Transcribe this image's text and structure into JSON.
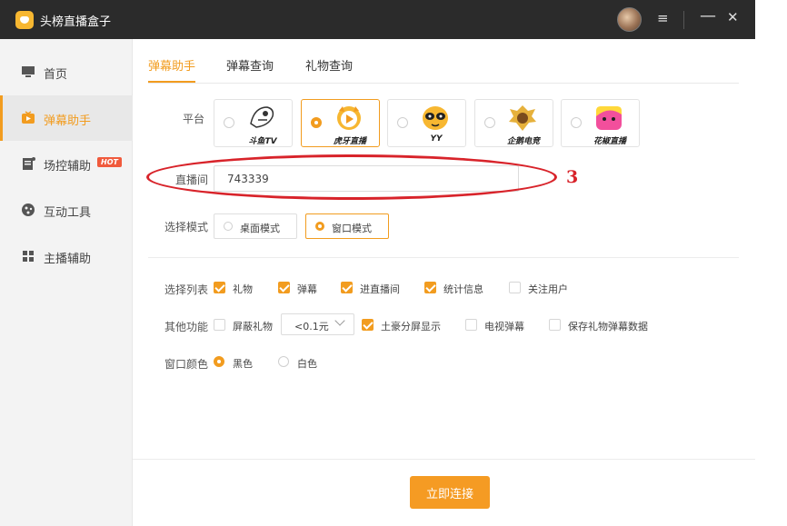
{
  "app": {
    "title": "头榜直播盒子"
  },
  "sidebar": {
    "items": [
      {
        "label": "首页",
        "icon": "monitor-icon"
      },
      {
        "label": "弹幕助手",
        "icon": "tv-play-icon",
        "active": true
      },
      {
        "label": "场控辅助",
        "icon": "document-icon",
        "badge": "HOT"
      },
      {
        "label": "互动工具",
        "icon": "palette-icon"
      },
      {
        "label": "主播辅助",
        "icon": "grid-icon"
      }
    ]
  },
  "tabs": [
    {
      "label": "弹幕助手",
      "active": true
    },
    {
      "label": "弹幕查询"
    },
    {
      "label": "礼物查询"
    }
  ],
  "platform": {
    "label": "平台",
    "options": [
      {
        "name": "斗鱼TV",
        "selected": false
      },
      {
        "name": "虎牙直播",
        "selected": true
      },
      {
        "name": "YY",
        "selected": false
      },
      {
        "name": "企鹅电竞",
        "selected": false
      },
      {
        "name": "花椒直播",
        "selected": false
      }
    ]
  },
  "room": {
    "label": "直播间",
    "value": "743339"
  },
  "annotation": {
    "number": "3"
  },
  "mode": {
    "label": "选择模式",
    "options": [
      {
        "label": "桌面模式",
        "selected": false
      },
      {
        "label": "窗口模式",
        "selected": true
      }
    ]
  },
  "list_select": {
    "label": "选择列表",
    "options": [
      {
        "label": "礼物",
        "checked": true
      },
      {
        "label": "弹幕",
        "checked": true
      },
      {
        "label": "进直播间",
        "checked": true
      },
      {
        "label": "统计信息",
        "checked": true
      },
      {
        "label": "关注用户",
        "checked": false
      }
    ]
  },
  "other": {
    "label": "其他功能",
    "block_gift": {
      "label": "屏蔽礼物",
      "checked": false
    },
    "threshold": "<0.1元",
    "split_screen": {
      "label": "土豪分屏显示",
      "checked": true
    },
    "tv_danmaku": {
      "label": "电视弹幕",
      "checked": false
    },
    "save_gift": {
      "label": "保存礼物弹幕数据",
      "checked": false
    }
  },
  "window_color": {
    "label": "窗口颜色",
    "options": [
      {
        "label": "黑色",
        "selected": true
      },
      {
        "label": "白色",
        "selected": false
      }
    ]
  },
  "connect_button": "立即连接",
  "colors": {
    "accent": "#f29c1f",
    "titlebar": "#2b2b2b",
    "annotation": "#d8232a"
  }
}
